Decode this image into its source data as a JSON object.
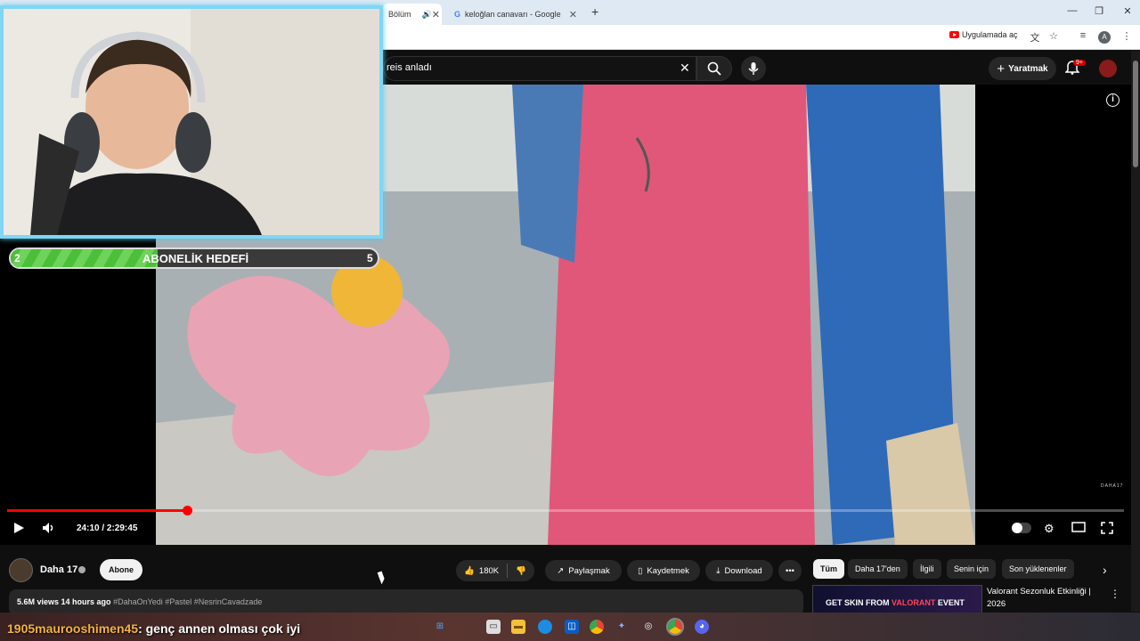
{
  "browser": {
    "tabs": [
      {
        "label": "Bölüm",
        "active": true
      },
      {
        "label": "keloğlan canavarı - Google Sea",
        "active": false
      }
    ],
    "open_in_app": "Uygulamada aç",
    "profile_initial": "A"
  },
  "header": {
    "search_query": "reis anladı",
    "create_label": "Yaratmak",
    "notif_count": "9+"
  },
  "player": {
    "time": "24:10 / 2:29:45",
    "progress_fraction": 0.161,
    "watermark": "DAHA17"
  },
  "overlay": {
    "goal_title": "ABONELİK HEDEFİ",
    "goal_current": "2",
    "goal_max": "5"
  },
  "channel": {
    "name": "Daha 17",
    "subscribe_label": "Abone"
  },
  "actions": {
    "likes": "180K",
    "share": "Paylaşmak",
    "save": "Kaydetmek",
    "download": "Download"
  },
  "description": {
    "stats": "5.6M views  14 hours ago",
    "tags": "#DahaOnYedi #Pastel #NesrinCavadzade"
  },
  "chips": [
    "Tüm",
    "Daha 17'den",
    "İlgili",
    "Senin için",
    "Son yüklenenler"
  ],
  "recommendation": {
    "thumb_prefix": "GET SKIN FROM",
    "thumb_game": "VALORANT",
    "thumb_suffix": "EVENT",
    "title": "Valorant Sezonluk Etkinliği | 2026"
  },
  "chat": {
    "user": "1905maurooshimen45",
    "message": ": genç annen olması çok iyi"
  },
  "colors": {
    "accent": "#ff0000",
    "cam_border": "#7fd6f5",
    "goal_green": "#4cbf3a"
  }
}
